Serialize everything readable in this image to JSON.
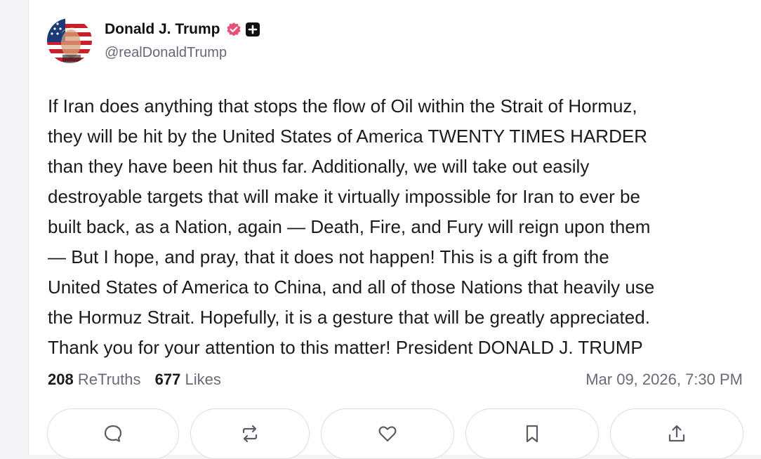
{
  "post": {
    "author": {
      "name": "Donald J. Trump",
      "handle": "@realDonaldTrump",
      "verified_icon": "verified-badge-icon",
      "plus_icon": "plus-icon"
    },
    "lines": [
      "If Iran does anything that stops the flow of Oil within the Strait of Hormuz,",
      "they will be hit by the United States of America TWENTY TIMES HARDER",
      "than they have been hit thus far. Additionally, we will take out easily",
      "destroyable targets that will make it virtually impossible for Iran to ever be",
      "built back, as a Nation, again — Death, Fire, and Fury will reign upon them",
      "— But I hope, and pray, that it does not happen! This is a gift from the",
      "United States of America to China, and all of those Nations that heavily use",
      "the Hormuz Strait. Hopefully, it is a gesture that will be greatly appreciated.",
      "Thank you for your attention to this matter! President DONALD J. TRUMP"
    ],
    "stats": {
      "retruths_count": "208",
      "retruths_label": "ReTruths",
      "likes_count": "677",
      "likes_label": "Likes"
    },
    "timestamp": "Mar 09, 2026, 7:30 PM",
    "actions": [
      {
        "name": "reply",
        "icon": "comment-icon"
      },
      {
        "name": "retruth",
        "icon": "repost-icon"
      },
      {
        "name": "like",
        "icon": "heart-icon"
      },
      {
        "name": "bookmark",
        "icon": "bookmark-icon"
      },
      {
        "name": "share",
        "icon": "share-icon"
      }
    ],
    "colors": {
      "verified_badge": "#e8507a",
      "text": "#1b1b1f",
      "muted": "#6a6a78"
    }
  }
}
